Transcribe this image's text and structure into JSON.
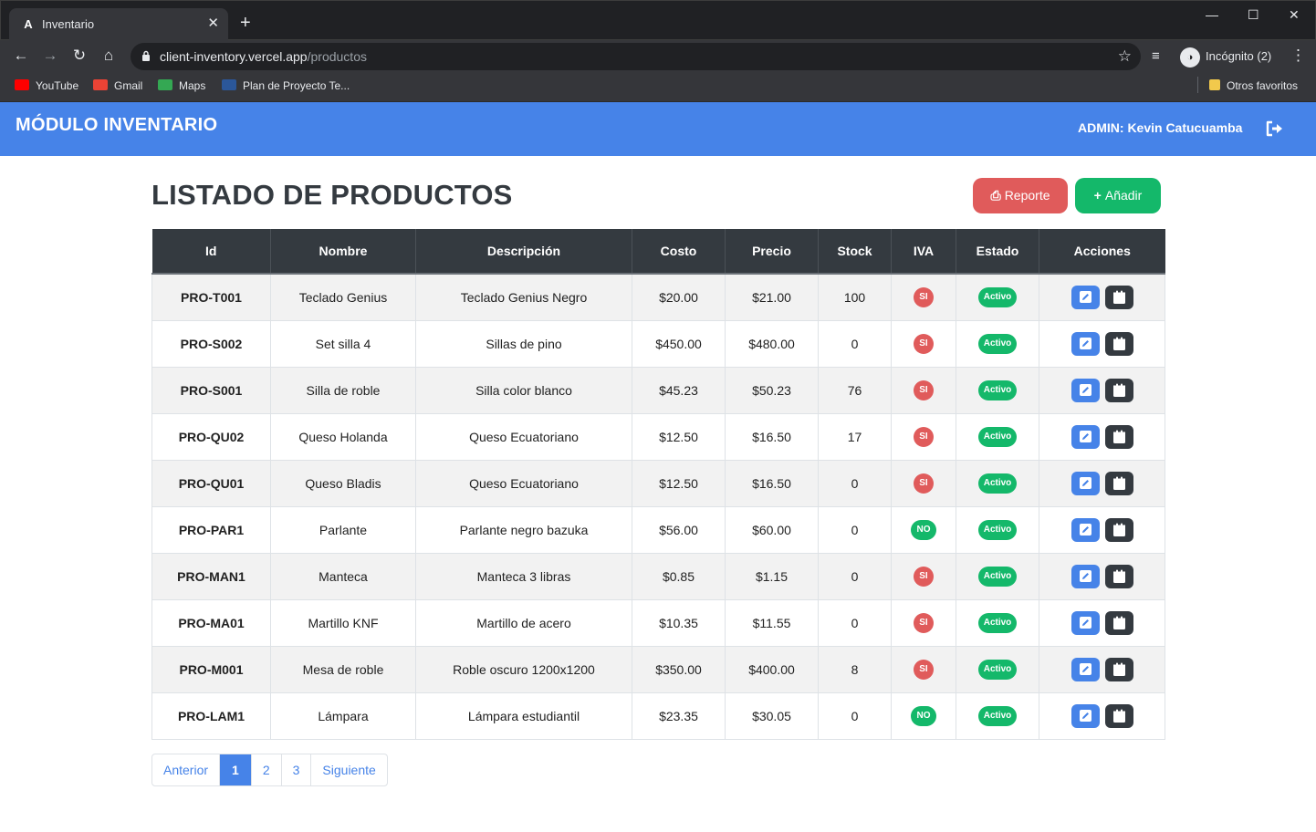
{
  "browser": {
    "tab_title": "Inventario",
    "tab_favicon": "A",
    "url_host": "client-inventory.vercel.app",
    "url_path": "/productos",
    "profile_label": "Incógnito (2)",
    "bookmarks": [
      "YouTube",
      "Gmail",
      "Maps",
      "Plan de Proyecto Te...",
      "Otros favoritos"
    ]
  },
  "header": {
    "brand": "MÓDULO INVENTARIO",
    "admin_label": "ADMIN:",
    "admin_name": "Kevin Catucuamba"
  },
  "main": {
    "title": "LISTADO DE PRODUCTOS",
    "report_label": "Reporte",
    "add_label": "Añadir"
  },
  "table": {
    "columns": [
      "Id",
      "Nombre",
      "Descripción",
      "Costo",
      "Precio",
      "Stock",
      "IVA",
      "Estado",
      "Acciones"
    ],
    "rows": [
      {
        "id": "PRO-T001",
        "nombre": "Teclado Genius",
        "descripcion": "Teclado Genius Negro",
        "costo": "$20.00",
        "precio": "$21.00",
        "stock": "100",
        "iva": "SI",
        "estado": "Activo"
      },
      {
        "id": "PRO-S002",
        "nombre": "Set silla 4",
        "descripcion": "Sillas de pino",
        "costo": "$450.00",
        "precio": "$480.00",
        "stock": "0",
        "iva": "SI",
        "estado": "Activo"
      },
      {
        "id": "PRO-S001",
        "nombre": "Silla de roble",
        "descripcion": "Silla color blanco",
        "costo": "$45.23",
        "precio": "$50.23",
        "stock": "76",
        "iva": "SI",
        "estado": "Activo"
      },
      {
        "id": "PRO-QU02",
        "nombre": "Queso Holanda",
        "descripcion": "Queso Ecuatoriano",
        "costo": "$12.50",
        "precio": "$16.50",
        "stock": "17",
        "iva": "SI",
        "estado": "Activo"
      },
      {
        "id": "PRO-QU01",
        "nombre": "Queso Bladis",
        "descripcion": "Queso Ecuatoriano",
        "costo": "$12.50",
        "precio": "$16.50",
        "stock": "0",
        "iva": "SI",
        "estado": "Activo"
      },
      {
        "id": "PRO-PAR1",
        "nombre": "Parlante",
        "descripcion": "Parlante negro bazuka",
        "costo": "$56.00",
        "precio": "$60.00",
        "stock": "0",
        "iva": "NO",
        "estado": "Activo"
      },
      {
        "id": "PRO-MAN1",
        "nombre": "Manteca",
        "descripcion": "Manteca 3 libras",
        "costo": "$0.85",
        "precio": "$1.15",
        "stock": "0",
        "iva": "SI",
        "estado": "Activo"
      },
      {
        "id": "PRO-MA01",
        "nombre": "Martillo KNF",
        "descripcion": "Martillo de acero",
        "costo": "$10.35",
        "precio": "$11.55",
        "stock": "0",
        "iva": "SI",
        "estado": "Activo"
      },
      {
        "id": "PRO-M001",
        "nombre": "Mesa de roble",
        "descripcion": "Roble oscuro 1200x1200",
        "costo": "$350.00",
        "precio": "$400.00",
        "stock": "8",
        "iva": "SI",
        "estado": "Activo"
      },
      {
        "id": "PRO-LAM1",
        "nombre": "Lámpara",
        "descripcion": "Lámpara estudiantil",
        "costo": "$23.35",
        "precio": "$30.05",
        "stock": "0",
        "iva": "NO",
        "estado": "Activo"
      }
    ]
  },
  "pagination": {
    "prev_label": "Anterior",
    "pages": [
      "1",
      "2",
      "3"
    ],
    "active_page": "1",
    "next_label": "Siguiente"
  },
  "colors": {
    "primary": "#4683e8",
    "danger": "#e05b5b",
    "success": "#14b86a",
    "dark": "#343a40"
  }
}
